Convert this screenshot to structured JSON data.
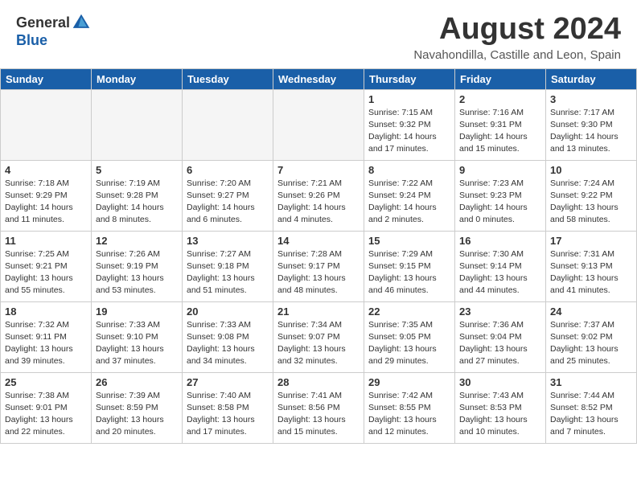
{
  "header": {
    "logo_general": "General",
    "logo_blue": "Blue",
    "month_year": "August 2024",
    "location": "Navahondilla, Castille and Leon, Spain"
  },
  "days_of_week": [
    "Sunday",
    "Monday",
    "Tuesday",
    "Wednesday",
    "Thursday",
    "Friday",
    "Saturday"
  ],
  "weeks": [
    [
      {
        "day": "",
        "info": ""
      },
      {
        "day": "",
        "info": ""
      },
      {
        "day": "",
        "info": ""
      },
      {
        "day": "",
        "info": ""
      },
      {
        "day": "1",
        "info": "Sunrise: 7:15 AM\nSunset: 9:32 PM\nDaylight: 14 hours\nand 17 minutes."
      },
      {
        "day": "2",
        "info": "Sunrise: 7:16 AM\nSunset: 9:31 PM\nDaylight: 14 hours\nand 15 minutes."
      },
      {
        "day": "3",
        "info": "Sunrise: 7:17 AM\nSunset: 9:30 PM\nDaylight: 14 hours\nand 13 minutes."
      }
    ],
    [
      {
        "day": "4",
        "info": "Sunrise: 7:18 AM\nSunset: 9:29 PM\nDaylight: 14 hours\nand 11 minutes."
      },
      {
        "day": "5",
        "info": "Sunrise: 7:19 AM\nSunset: 9:28 PM\nDaylight: 14 hours\nand 8 minutes."
      },
      {
        "day": "6",
        "info": "Sunrise: 7:20 AM\nSunset: 9:27 PM\nDaylight: 14 hours\nand 6 minutes."
      },
      {
        "day": "7",
        "info": "Sunrise: 7:21 AM\nSunset: 9:26 PM\nDaylight: 14 hours\nand 4 minutes."
      },
      {
        "day": "8",
        "info": "Sunrise: 7:22 AM\nSunset: 9:24 PM\nDaylight: 14 hours\nand 2 minutes."
      },
      {
        "day": "9",
        "info": "Sunrise: 7:23 AM\nSunset: 9:23 PM\nDaylight: 14 hours\nand 0 minutes."
      },
      {
        "day": "10",
        "info": "Sunrise: 7:24 AM\nSunset: 9:22 PM\nDaylight: 13 hours\nand 58 minutes."
      }
    ],
    [
      {
        "day": "11",
        "info": "Sunrise: 7:25 AM\nSunset: 9:21 PM\nDaylight: 13 hours\nand 55 minutes."
      },
      {
        "day": "12",
        "info": "Sunrise: 7:26 AM\nSunset: 9:19 PM\nDaylight: 13 hours\nand 53 minutes."
      },
      {
        "day": "13",
        "info": "Sunrise: 7:27 AM\nSunset: 9:18 PM\nDaylight: 13 hours\nand 51 minutes."
      },
      {
        "day": "14",
        "info": "Sunrise: 7:28 AM\nSunset: 9:17 PM\nDaylight: 13 hours\nand 48 minutes."
      },
      {
        "day": "15",
        "info": "Sunrise: 7:29 AM\nSunset: 9:15 PM\nDaylight: 13 hours\nand 46 minutes."
      },
      {
        "day": "16",
        "info": "Sunrise: 7:30 AM\nSunset: 9:14 PM\nDaylight: 13 hours\nand 44 minutes."
      },
      {
        "day": "17",
        "info": "Sunrise: 7:31 AM\nSunset: 9:13 PM\nDaylight: 13 hours\nand 41 minutes."
      }
    ],
    [
      {
        "day": "18",
        "info": "Sunrise: 7:32 AM\nSunset: 9:11 PM\nDaylight: 13 hours\nand 39 minutes."
      },
      {
        "day": "19",
        "info": "Sunrise: 7:33 AM\nSunset: 9:10 PM\nDaylight: 13 hours\nand 37 minutes."
      },
      {
        "day": "20",
        "info": "Sunrise: 7:33 AM\nSunset: 9:08 PM\nDaylight: 13 hours\nand 34 minutes."
      },
      {
        "day": "21",
        "info": "Sunrise: 7:34 AM\nSunset: 9:07 PM\nDaylight: 13 hours\nand 32 minutes."
      },
      {
        "day": "22",
        "info": "Sunrise: 7:35 AM\nSunset: 9:05 PM\nDaylight: 13 hours\nand 29 minutes."
      },
      {
        "day": "23",
        "info": "Sunrise: 7:36 AM\nSunset: 9:04 PM\nDaylight: 13 hours\nand 27 minutes."
      },
      {
        "day": "24",
        "info": "Sunrise: 7:37 AM\nSunset: 9:02 PM\nDaylight: 13 hours\nand 25 minutes."
      }
    ],
    [
      {
        "day": "25",
        "info": "Sunrise: 7:38 AM\nSunset: 9:01 PM\nDaylight: 13 hours\nand 22 minutes."
      },
      {
        "day": "26",
        "info": "Sunrise: 7:39 AM\nSunset: 8:59 PM\nDaylight: 13 hours\nand 20 minutes."
      },
      {
        "day": "27",
        "info": "Sunrise: 7:40 AM\nSunset: 8:58 PM\nDaylight: 13 hours\nand 17 minutes."
      },
      {
        "day": "28",
        "info": "Sunrise: 7:41 AM\nSunset: 8:56 PM\nDaylight: 13 hours\nand 15 minutes."
      },
      {
        "day": "29",
        "info": "Sunrise: 7:42 AM\nSunset: 8:55 PM\nDaylight: 13 hours\nand 12 minutes."
      },
      {
        "day": "30",
        "info": "Sunrise: 7:43 AM\nSunset: 8:53 PM\nDaylight: 13 hours\nand 10 minutes."
      },
      {
        "day": "31",
        "info": "Sunrise: 7:44 AM\nSunset: 8:52 PM\nDaylight: 13 hours\nand 7 minutes."
      }
    ]
  ]
}
